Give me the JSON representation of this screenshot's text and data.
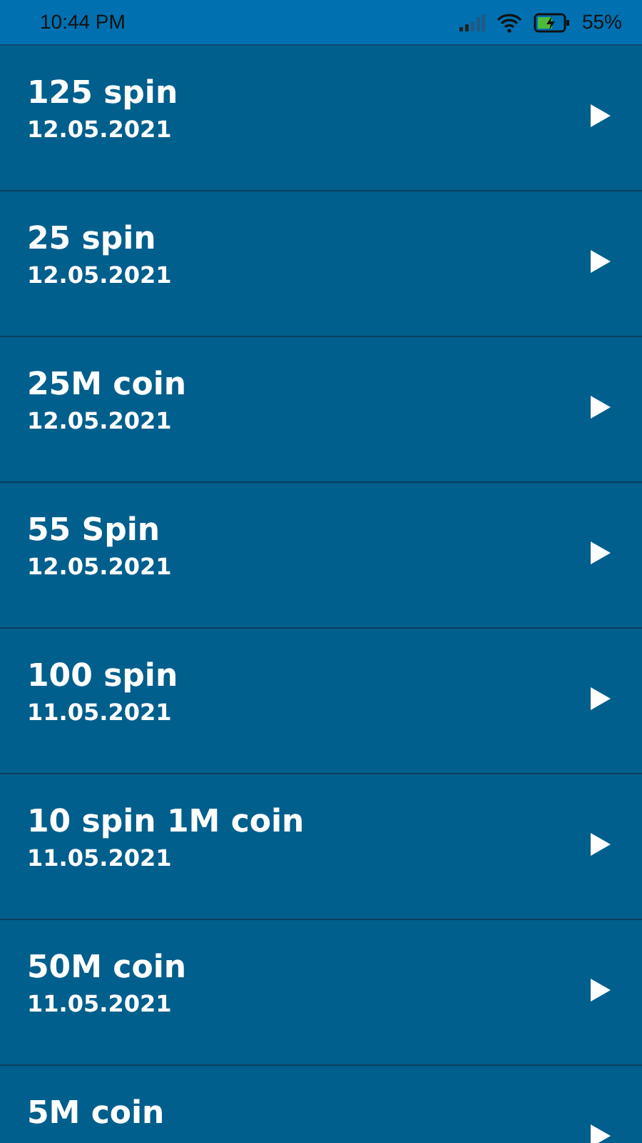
{
  "status_bar": {
    "time": "10:44 PM",
    "battery": "55%"
  },
  "items": [
    {
      "title": "125 spin",
      "date": "12.05.2021"
    },
    {
      "title": "25 spin",
      "date": "12.05.2021"
    },
    {
      "title": "25M coin",
      "date": "12.05.2021"
    },
    {
      "title": "55 Spin",
      "date": "12.05.2021"
    },
    {
      "title": "100 spin",
      "date": "11.05.2021"
    },
    {
      "title": "10 spin 1M coin",
      "date": "11.05.2021"
    },
    {
      "title": "50M coin",
      "date": "11.05.2021"
    },
    {
      "title": "5M coin"
    }
  ]
}
